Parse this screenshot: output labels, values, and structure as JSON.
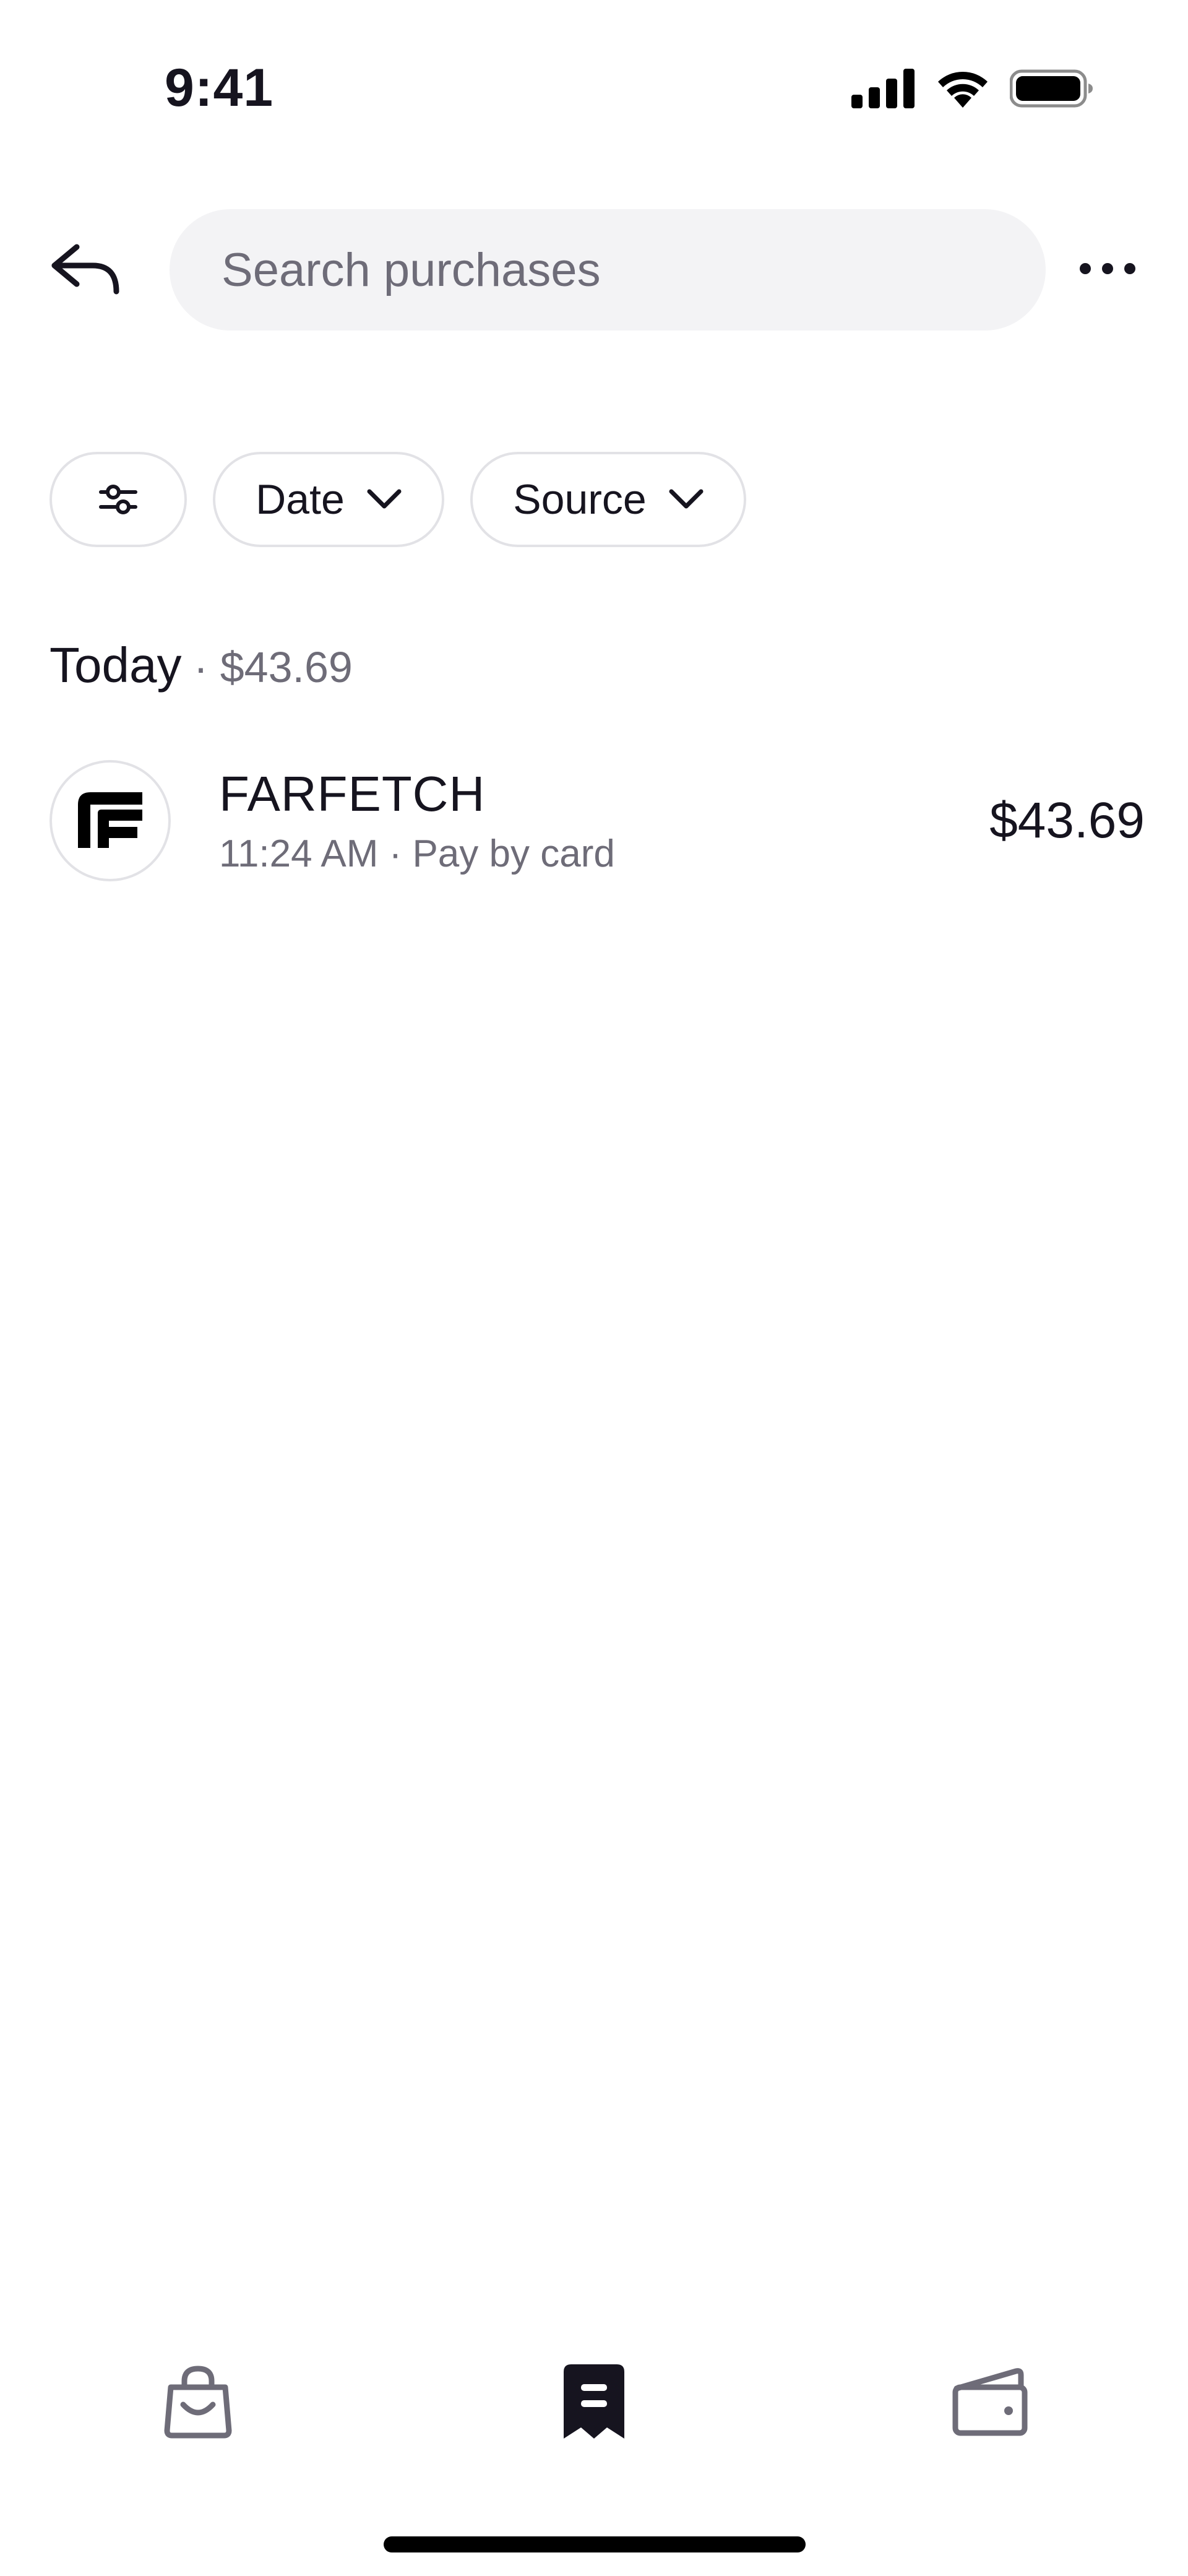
{
  "status_bar": {
    "time": "9:41",
    "icons": [
      "cellular-signal-icon",
      "wifi-icon",
      "battery-icon"
    ]
  },
  "header": {
    "back_icon": "reply-back-arrow-icon",
    "search": {
      "placeholder": "Search purchases",
      "value": ""
    },
    "more_icon": "more-horizontal-icon"
  },
  "filters": {
    "settings_icon": "sliders-icon",
    "date_label": "Date",
    "source_label": "Source",
    "dropdown_icon": "chevron-down-icon"
  },
  "sections": [
    {
      "title": "Today",
      "separator": " · ",
      "total": "$43.69",
      "purchases": [
        {
          "merchant": "FARFETCH",
          "meta": "11:24 AM · Pay by card",
          "amount": "$43.69",
          "logo": "farfetch-logo"
        }
      ]
    }
  ],
  "bottom_nav": {
    "items": [
      {
        "icon": "shopping-bag-icon",
        "active": false
      },
      {
        "icon": "receipt-icon",
        "active": true
      },
      {
        "icon": "wallet-icon",
        "active": false
      }
    ]
  },
  "colors": {
    "text_primary": "#16141f",
    "text_secondary": "#6e6c78",
    "search_bg": "#f3f3f5",
    "border": "#e2e2e6",
    "icon_inactive": "#6e6c78"
  }
}
